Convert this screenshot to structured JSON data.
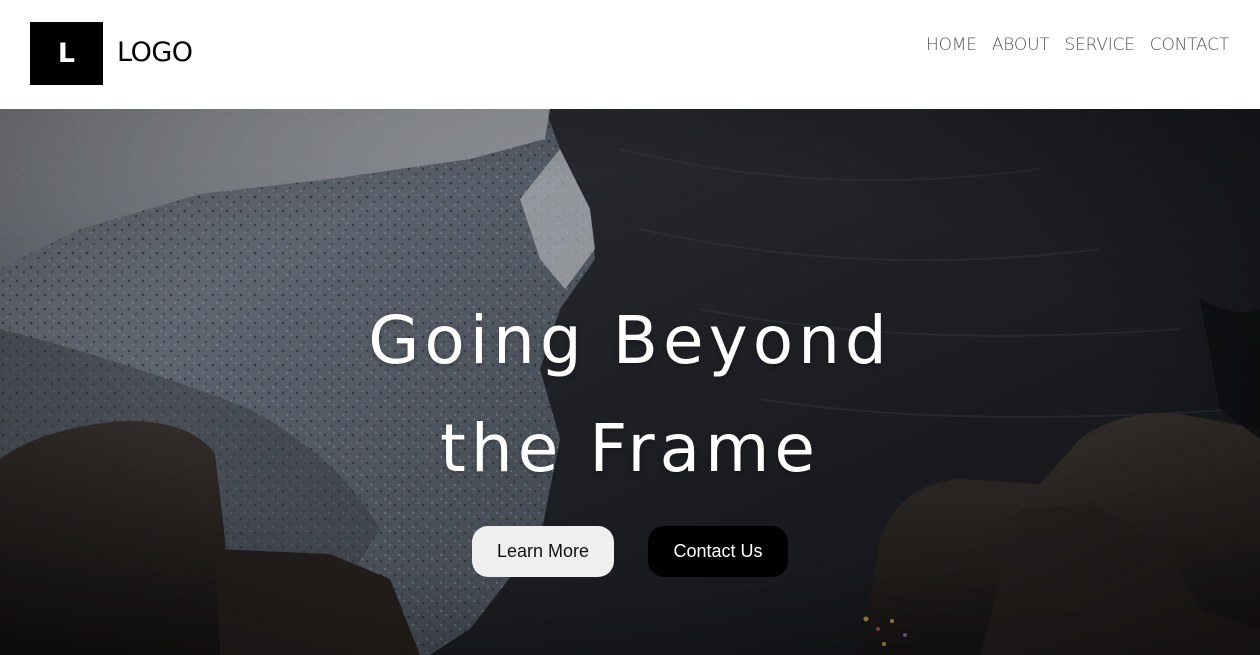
{
  "header": {
    "logo_mark": "L",
    "logo_text": "LOGO",
    "nav": [
      {
        "label": "HOME"
      },
      {
        "label": "ABOUT"
      },
      {
        "label": "SERVICE"
      },
      {
        "label": "CONTACT"
      }
    ]
  },
  "hero": {
    "title_line1": "Going Beyond",
    "title_line2": "the Frame",
    "buttons": {
      "learn_more": "Learn More",
      "contact_us": "Contact Us"
    }
  },
  "colors": {
    "header_bg": "#ffffff",
    "logo_bg": "#000000",
    "nav_text": "#555555",
    "hero_title": "#ffffff",
    "learn_more_bg": "#efefef",
    "contact_bg": "#000000"
  }
}
